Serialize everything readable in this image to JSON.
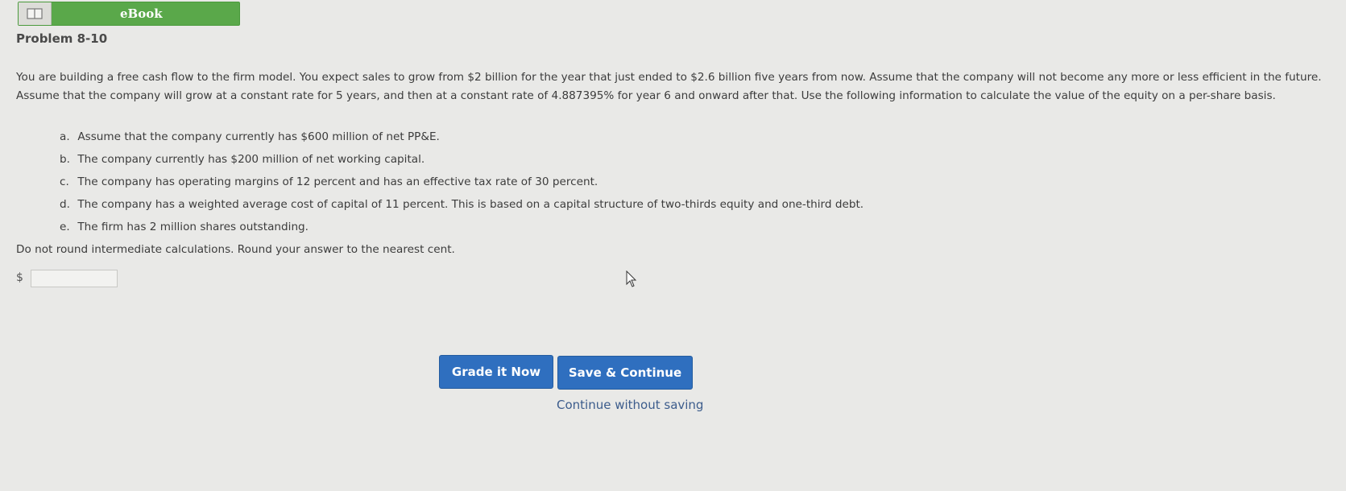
{
  "header": {
    "ebook_label": "eBook",
    "icon": "book-icon"
  },
  "problem": {
    "title": "Problem 8-10",
    "intro": "You are building a free cash flow to the firm model. You expect sales to grow from $2 billion for the year that just ended to $2.6 billion five years from now. Assume that the company will not become any more or less efficient in the future. Assume that the company will grow at a constant rate for 5 years, and then at a constant rate of 4.887395% for year 6 and onward after that. Use the following information to calculate the value of the equity on a per-share basis.",
    "items": [
      {
        "letter": "a.",
        "text": "Assume that the company currently has $600 million of net PP&E."
      },
      {
        "letter": "b.",
        "text": "The company currently has $200 million of net working capital."
      },
      {
        "letter": "c.",
        "text": "The company has operating margins of 12 percent and has an effective tax rate of 30 percent."
      },
      {
        "letter": "d.",
        "text": "The company has a weighted average cost of capital of 11 percent. This is based on a capital structure of two-thirds equity and one-third debt."
      },
      {
        "letter": "e.",
        "text": "The firm has 2 million shares outstanding."
      }
    ],
    "instruction": "Do not round intermediate calculations. Round your answer to the nearest cent."
  },
  "answer": {
    "currency_symbol": "$",
    "value": ""
  },
  "actions": {
    "grade_label": "Grade it Now",
    "save_label": "Save & Continue",
    "continue_label": "Continue without saving"
  },
  "colors": {
    "ebook_green": "#5aa84a",
    "button_blue": "#2f6fbf",
    "background": "#e9e9e7"
  }
}
